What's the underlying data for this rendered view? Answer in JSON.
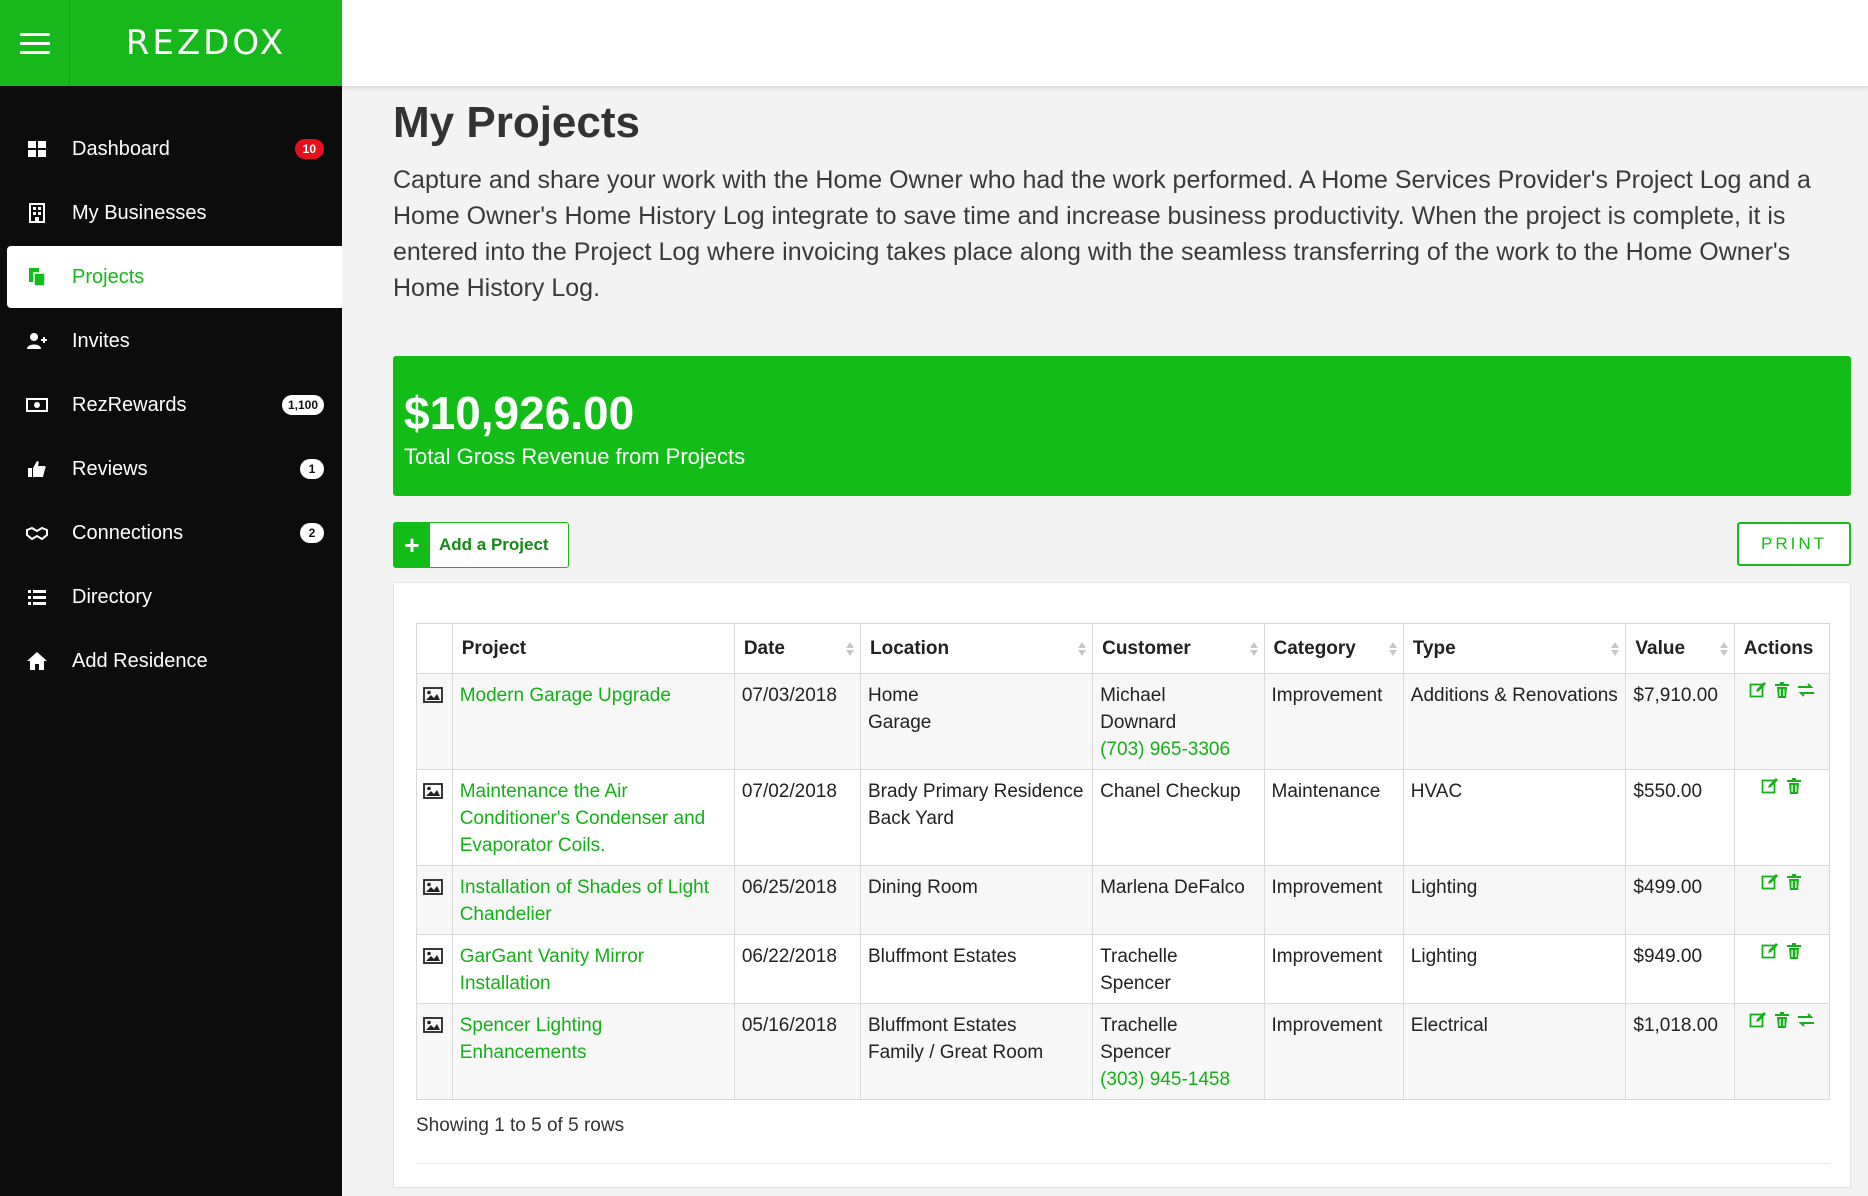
{
  "brand": {
    "logo": "REZDOX",
    "accent": "#17b81b"
  },
  "sidebar": {
    "items": [
      {
        "label": "Dashboard",
        "icon": "dashboard-icon",
        "badge": "10",
        "badge_style": "red",
        "active": false
      },
      {
        "label": "My Businesses",
        "icon": "building-icon",
        "badge": "",
        "active": false
      },
      {
        "label": "Projects",
        "icon": "projects-icon",
        "badge": "",
        "active": true
      },
      {
        "label": "Invites",
        "icon": "user-plus-icon",
        "badge": "",
        "active": false
      },
      {
        "label": "RezRewards",
        "icon": "money-icon",
        "badge": "1,100",
        "badge_style": "white",
        "active": false
      },
      {
        "label": "Reviews",
        "icon": "thumbs-up-icon",
        "badge": "1",
        "badge_style": "white",
        "active": false
      },
      {
        "label": "Connections",
        "icon": "handshake-icon",
        "badge": "2",
        "badge_style": "white",
        "active": false
      },
      {
        "label": "Directory",
        "icon": "list-icon",
        "badge": "",
        "active": false
      },
      {
        "label": "Add Residence",
        "icon": "home-icon",
        "badge": "",
        "active": false
      }
    ]
  },
  "page": {
    "title": "My Projects",
    "description": "Capture and share your work with the Home Owner who had the work performed. A Home Services Provider's Project Log and a Home Owner's Home History Log integrate to save time and increase business productivity. When the project is complete, it is entered into the Project Log where invoicing takes place along with the seamless transferring of the work to the Home Owner's Home History Log."
  },
  "revenue": {
    "amount": "$10,926.00",
    "label": "Total Gross Revenue from Projects"
  },
  "toolbar": {
    "add_label": "Add a Project",
    "add_icon": "+",
    "print_label": "PRINT"
  },
  "table": {
    "columns": [
      "Project",
      "Date",
      "Location",
      "Customer",
      "Category",
      "Type",
      "Value",
      "Actions"
    ],
    "rows": [
      {
        "project": "Modern Garage Upgrade",
        "date": "07/03/2018",
        "location": [
          "Home",
          "Garage"
        ],
        "customer": [
          "Michael",
          "Downard"
        ],
        "phone": "(703) 965-3306",
        "category": "Improvement",
        "type": "Additions & Renovations",
        "value": "$7,910.00",
        "transfer": true
      },
      {
        "project": "Maintenance the Air Conditioner's Condenser and Evaporator Coils.",
        "date": "07/02/2018",
        "location": [
          "Brady Primary Residence",
          "Back Yard"
        ],
        "customer": [
          "Chanel Checkup"
        ],
        "phone": "",
        "category": "Maintenance",
        "type": "HVAC",
        "value": "$550.00",
        "transfer": false
      },
      {
        "project": "Installation of Shades of Light Chandelier",
        "date": "06/25/2018",
        "location": [
          "Dining Room"
        ],
        "customer": [
          "Marlena DeFalco"
        ],
        "phone": "",
        "category": "Improvement",
        "type": "Lighting",
        "value": "$499.00",
        "transfer": false
      },
      {
        "project": "GarGant Vanity Mirror Installation",
        "date": "06/22/2018",
        "location": [
          "Bluffmont Estates"
        ],
        "customer": [
          "Trachelle",
          "Spencer"
        ],
        "phone": "",
        "category": "Improvement",
        "type": "Lighting",
        "value": "$949.00",
        "transfer": false
      },
      {
        "project": "Spencer Lighting Enhancements",
        "date": "05/16/2018",
        "location": [
          "Bluffmont Estates",
          "Family / Great Room"
        ],
        "customer": [
          "Trachelle",
          "Spencer"
        ],
        "phone": "(303) 945-1458",
        "category": "Improvement",
        "type": "Electrical",
        "value": "$1,018.00",
        "transfer": true
      }
    ],
    "footer": "Showing 1 to 5 of 5 rows"
  }
}
